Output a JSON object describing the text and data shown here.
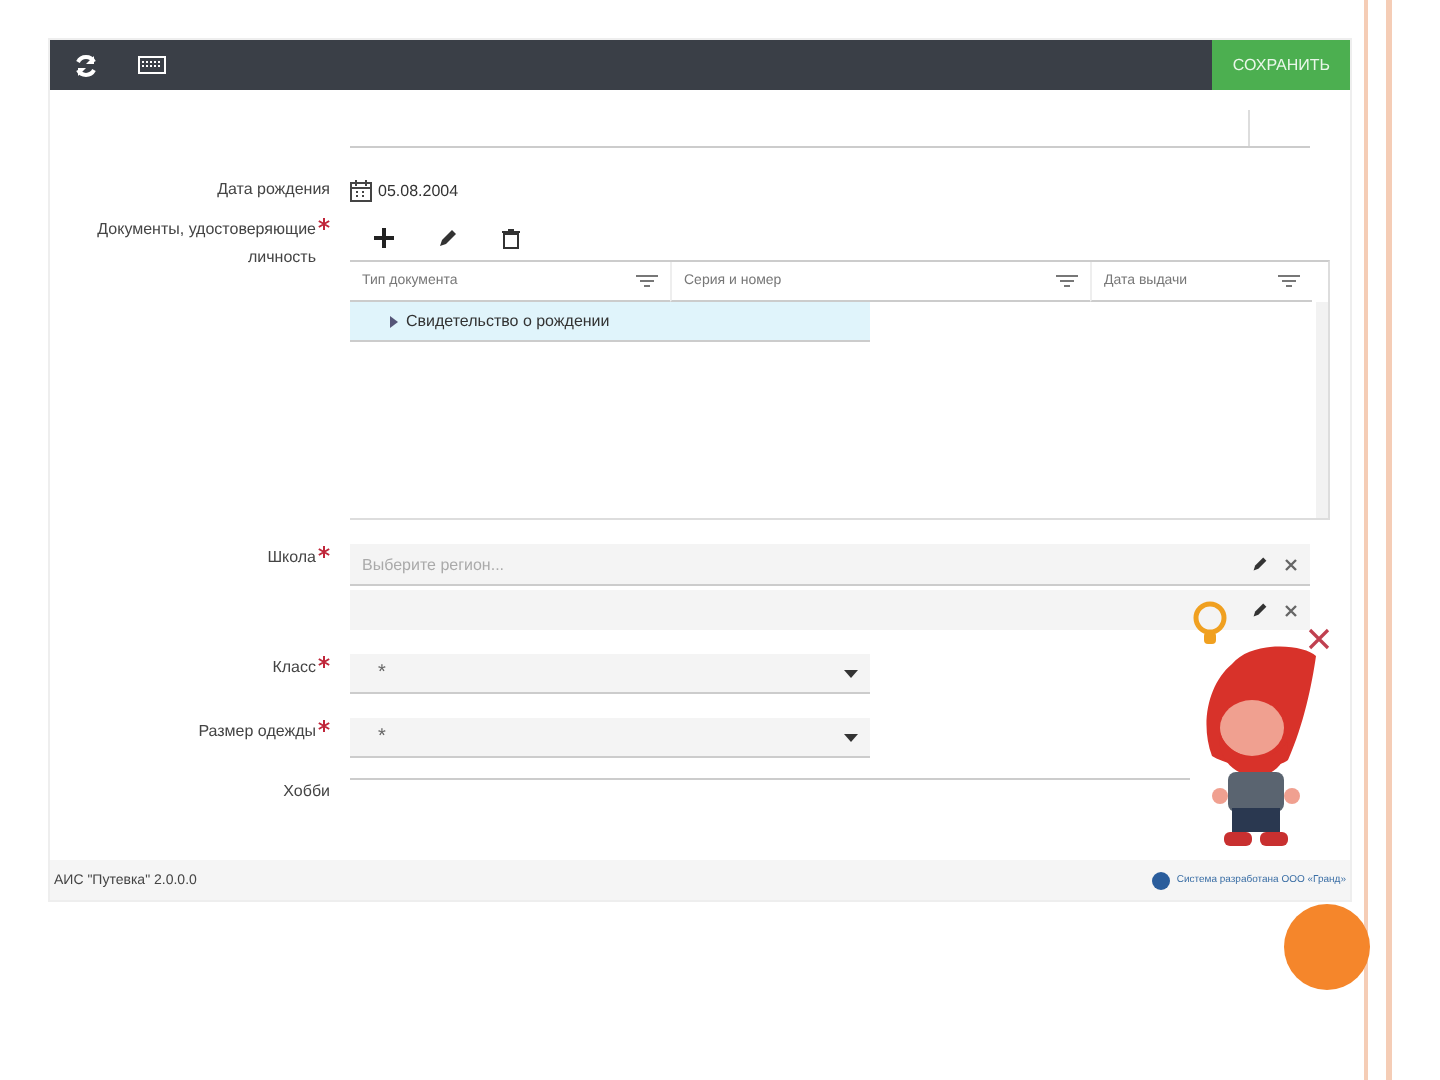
{
  "toolbar": {
    "save_button": "СОХРАНИТЬ"
  },
  "fields": [
    {
      "kind": "blank"
    },
    {
      "kind": "date",
      "label": "Дата рождения",
      "required": false,
      "value": "05.08.2004"
    },
    {
      "kind": "documents",
      "label": "Документы, удостоверяющие личность",
      "required": true,
      "table": {
        "columns": [
          "Тип документа",
          "Серия и номер",
          "Дата выдачи"
        ],
        "rows": [
          {
            "cells": [
              "Свидетельство о рождении"
            ],
            "selected": true
          }
        ]
      }
    },
    {
      "kind": "school",
      "label": "Школа",
      "required": true,
      "placeholder": "Выберите регион..."
    },
    {
      "kind": "select",
      "label": "Класс",
      "required": true,
      "value": "*"
    },
    {
      "kind": "select",
      "label": "Размер одежды",
      "required": true,
      "value": "*"
    },
    {
      "kind": "textarea",
      "label": "Хобби",
      "required": false
    }
  ],
  "footer": {
    "version": "АИС \"Путевка\" 2.0.0.0",
    "credit": "Система разработана ООО «Гранд»"
  }
}
